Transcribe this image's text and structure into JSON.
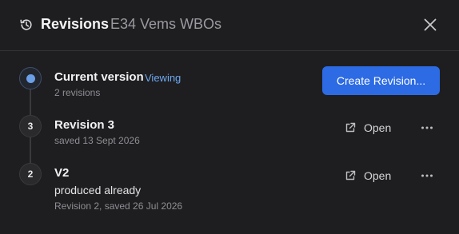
{
  "header": {
    "title": "Revisions",
    "subtitle": "E34 Vems WBOs",
    "history_icon": "history-icon",
    "close_icon": "close-icon"
  },
  "current": {
    "title": "Current version",
    "badge": "Viewing",
    "meta": "2 revisions"
  },
  "actions": {
    "create_label": "Create Revision...",
    "accent": "#2d6be4"
  },
  "revisions": [
    {
      "number": "3",
      "title": "Revision 3",
      "note": "",
      "meta": "saved 13 Sept 2026",
      "open_label": "Open"
    },
    {
      "number": "2",
      "title": "V2",
      "note": "produced already",
      "meta": "Revision 2, saved 26 Jul 2026",
      "open_label": "Open"
    }
  ]
}
